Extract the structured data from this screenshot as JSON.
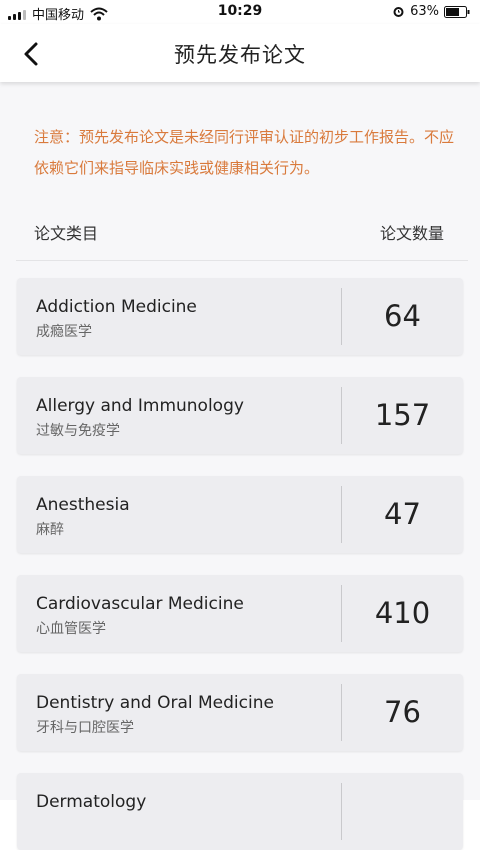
{
  "status_bar": {
    "carrier": "中国移动",
    "time": "10:29",
    "battery": "63%"
  },
  "header": {
    "title": "预先发布论文",
    "back_icon": "chevron-left-icon"
  },
  "notice": "注意：预先发布论文是未经同行评审认证的初步工作报告。不应依赖它们来指导临床实践或健康相关行为。",
  "list_header": {
    "category": "论文类目",
    "count": "论文数量"
  },
  "categories": [
    {
      "name_en": "Addiction Medicine",
      "name_zh": "成瘾医学",
      "count": "64"
    },
    {
      "name_en": "Allergy and Immunology",
      "name_zh": "过敏与免疫学",
      "count": "157"
    },
    {
      "name_en": "Anesthesia",
      "name_zh": "麻醉",
      "count": "47"
    },
    {
      "name_en": "Cardiovascular Medicine",
      "name_zh": "心血管医学",
      "count": "410"
    },
    {
      "name_en": "Dentistry and Oral Medicine",
      "name_zh": "牙科与口腔医学",
      "count": "76"
    },
    {
      "name_en": "Dermatology",
      "name_zh": "",
      "count": ""
    }
  ],
  "colors": {
    "notice_text": "#d97a3c",
    "card_bg": "#ededf0",
    "page_bg": "#f7f7f9"
  }
}
